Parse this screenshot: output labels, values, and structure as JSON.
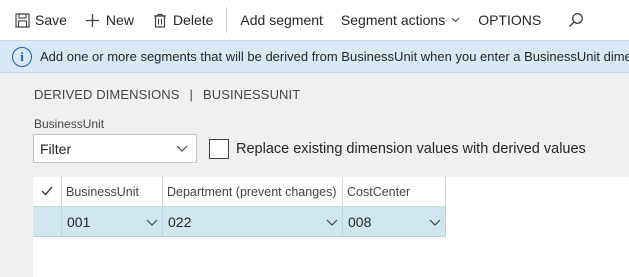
{
  "toolbar": {
    "save_label": "Save",
    "new_label": "New",
    "delete_label": "Delete",
    "add_segment_label": "Add segment",
    "segment_actions_label": "Segment actions",
    "options_label": "OPTIONS"
  },
  "infobar": {
    "message": "Add one or more segments that will be derived from BusinessUnit when you enter a BusinessUnit dimension value"
  },
  "breadcrumb": {
    "parent": "DERIVED DIMENSIONS",
    "separator": "|",
    "current": "BUSINESSUNIT"
  },
  "filter": {
    "label": "BusinessUnit",
    "value": "Filter"
  },
  "replace_option": {
    "label": "Replace existing dimension values with derived values",
    "checked": false
  },
  "grid": {
    "columns": [
      "BusinessUnit",
      "Department (prevent changes)",
      "CostCenter"
    ],
    "rows": [
      {
        "business_unit": "001",
        "department": "022",
        "cost_center": "008"
      }
    ]
  },
  "colors": {
    "info_background": "#d9e8f5",
    "info_icon": "#1a5ea8",
    "selected_row": "#cfe6ee",
    "page_background": "#f0f0f0"
  },
  "icons": [
    "save-icon",
    "plus-icon",
    "trash-icon",
    "search-icon",
    "info-icon",
    "chevron-down-icon",
    "checkmark-icon"
  ]
}
